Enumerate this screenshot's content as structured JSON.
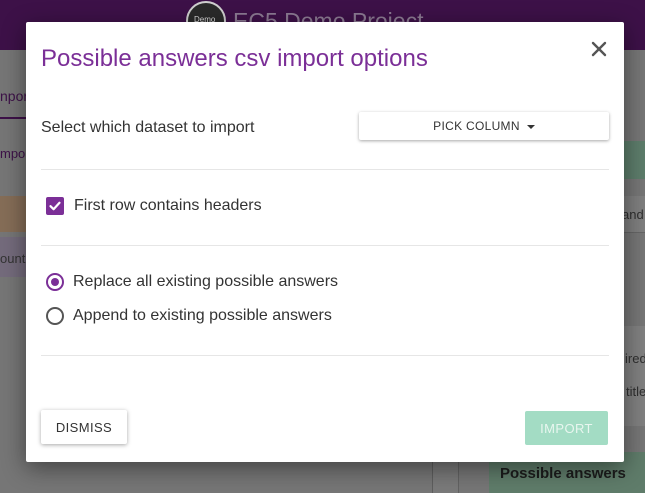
{
  "background": {
    "app_title": "EC5 Demo Project",
    "logo_text": "Demo",
    "left_tab_fragment": "nport",
    "left_import_fragment": "mpor",
    "left_count_fragment": "ount",
    "right_field_fragment": "and",
    "right_required_fragment": "ired",
    "right_title_fragment": "title",
    "right_possible_answers": "Possible answers"
  },
  "modal": {
    "title": "Possible answers csv import options",
    "close_icon": "close-icon",
    "dataset_label": "Select which dataset to import",
    "pick_column_label": "PICK COLUMN",
    "headers_checkbox": {
      "label": "First row contains headers",
      "checked": true
    },
    "import_mode": {
      "options": [
        {
          "label": "Replace all existing possible answers",
          "selected": true
        },
        {
          "label": "Append to existing possible answers",
          "selected": false
        }
      ]
    },
    "dismiss_label": "DISMISS",
    "import_label": "IMPORT",
    "import_enabled": false
  },
  "colors": {
    "accent": "#7b2f97",
    "import_disabled": "#a3dcc4",
    "topbar": "#3d1148"
  }
}
